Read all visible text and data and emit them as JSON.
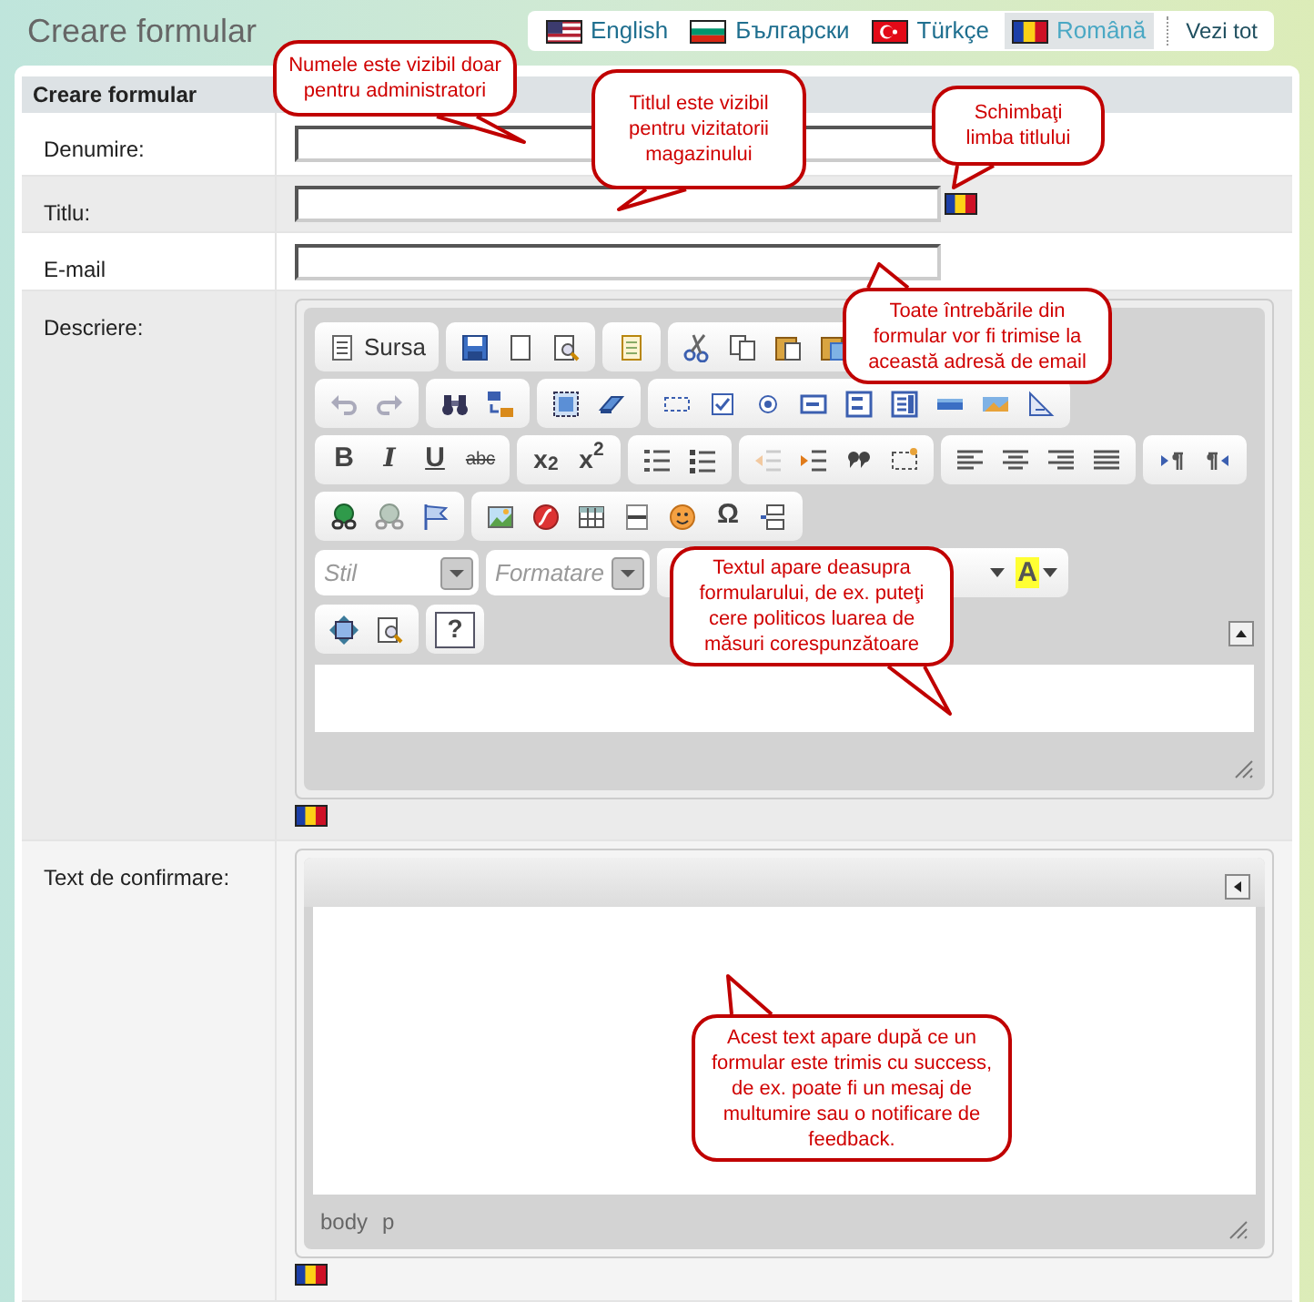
{
  "page_title": "Creare formular",
  "languages": [
    {
      "label": "English",
      "selected": false
    },
    {
      "label": "Български",
      "selected": false
    },
    {
      "label": "Türkçe",
      "selected": false
    },
    {
      "label": "Română",
      "selected": true
    }
  ],
  "view_all": "Vezi tot",
  "section_title": "Creare formular",
  "rows": [
    {
      "label": "Denumire:",
      "kind": "input",
      "flag": false
    },
    {
      "label": "Titlu:",
      "kind": "input",
      "flag": true
    },
    {
      "label": "E-mail",
      "kind": "input",
      "flag": false
    },
    {
      "label": "Descriere:",
      "kind": "editor",
      "flag": true
    },
    {
      "label": "Text de confirmare:",
      "kind": "collapsed_editor",
      "flag": true
    }
  ],
  "editor": {
    "source": "Sursa",
    "style": "Stil",
    "format": "Formatare",
    "bold": "B",
    "italic": "I",
    "underline": "U",
    "strike": "abc",
    "sub": "x$_{2}$",
    "sup": "x$^{2}$",
    "omega": "Ω",
    "help": "?",
    "highlight": "A"
  },
  "path": [
    "body",
    "p"
  ],
  "callouts": [
    "Numele este vizibil doar pentru administratori",
    "Titlul este vizibil pentru vizitatorii magazinului",
    "Schimbaţi limba titlului",
    "Toate întrebările din formular vor fi trimise la această adresă de email",
    "Textul apare deasupra formularului, de ex. puteţi cere politicos luarea de măsuri corespunzătoare",
    "Acest text apare după ce un formular este trimis cu success, de ex. poate fi un mesaj de multumire sau o notificare de feedback."
  ]
}
